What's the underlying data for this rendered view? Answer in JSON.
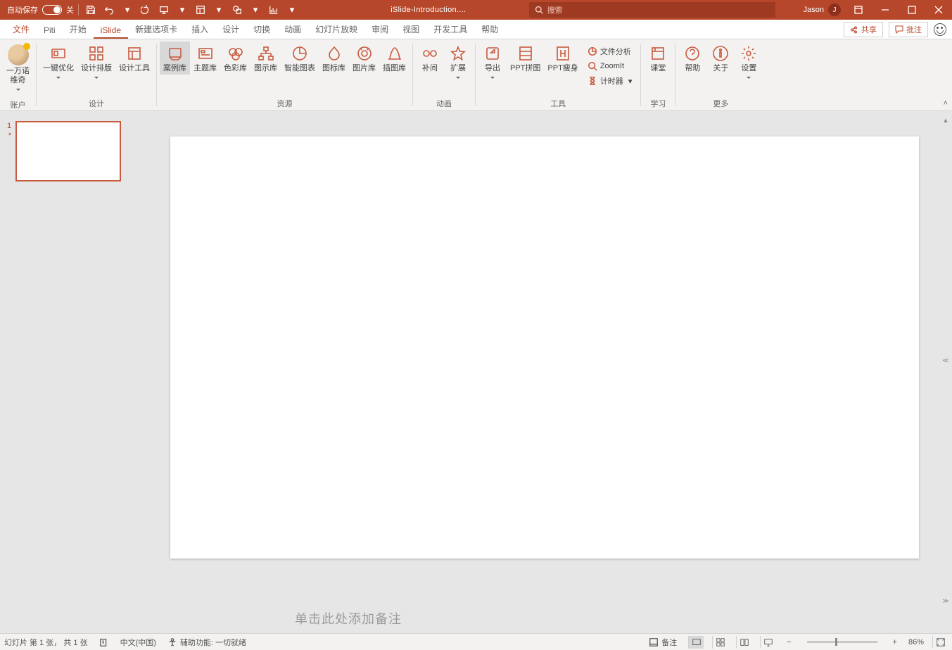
{
  "title_bar": {
    "autosave_label": "自动保存",
    "autosave_state": "关",
    "doc_title": "iSlide-Introduction....",
    "search_placeholder": "搜索",
    "user_name": "Jason",
    "user_initial": "J"
  },
  "menu": {
    "tabs": [
      "文件",
      "Piti",
      "开始",
      "iSlide",
      "新建选项卡",
      "插入",
      "设计",
      "切换",
      "动画",
      "幻灯片放映",
      "审阅",
      "视图",
      "开发工具",
      "帮助"
    ],
    "active_index": 3,
    "share": "共享",
    "comments": "批注"
  },
  "ribbon": {
    "groups": {
      "account": {
        "label": "账户",
        "btn": "一万诺\n维奇"
      },
      "design": {
        "label": "设计",
        "btns": [
          "一键优化",
          "设计排版",
          "设计工具"
        ]
      },
      "resource": {
        "label": "资源",
        "btns": [
          "案例库",
          "主题库",
          "色彩库",
          "图示库",
          "智能图表",
          "图标库",
          "图片库",
          "插图库"
        ],
        "selected": 0
      },
      "anim": {
        "label": "动画",
        "btns": [
          "补间",
          "扩展"
        ]
      },
      "tools": {
        "label": "工具",
        "btns": [
          "导出",
          "PPT拼图",
          "PPT瘦身"
        ],
        "mini": [
          "文件分析",
          "ZoomIt",
          "计时器"
        ]
      },
      "study": {
        "label": "学习",
        "btns": [
          "课堂"
        ]
      },
      "more": {
        "label": "更多",
        "btns": [
          "帮助",
          "关于",
          "设置"
        ]
      }
    }
  },
  "thumbs": {
    "index": "1",
    "anim_marker": "*"
  },
  "notes_hint": "单击此处添加备注",
  "status": {
    "slide_pos": "幻灯片 第 1 张， 共 1 张",
    "lang": "中文(中国)",
    "a11y": "辅助功能: 一切就绪",
    "notes_btn": "备注",
    "zoom_pct": "86%"
  }
}
